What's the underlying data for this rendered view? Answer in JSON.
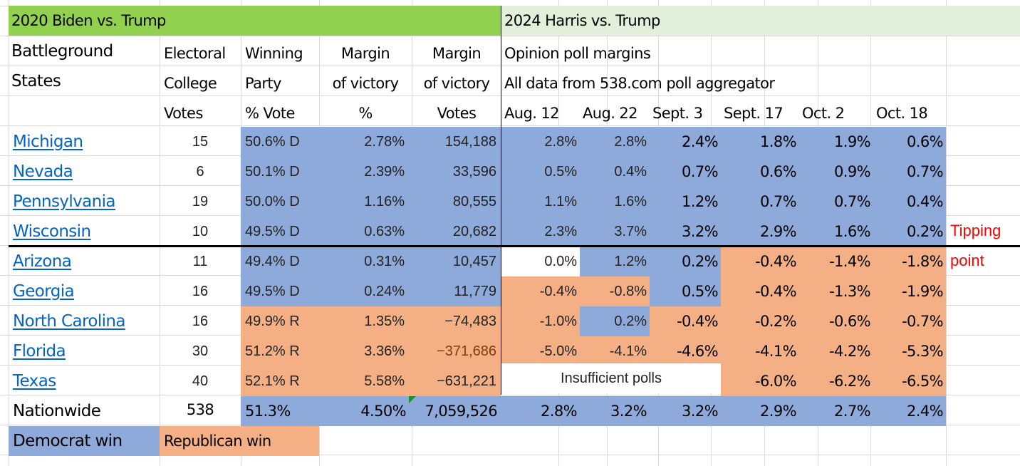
{
  "header": {
    "section_2020": "2020 Biden vs. Trump",
    "section_2024": "2024 Harris vs. Trump",
    "col_state": [
      "Battleground",
      "States",
      ""
    ],
    "col_ec": [
      "Electoral",
      "College",
      "Votes"
    ],
    "col_party": [
      "Winning",
      "Party",
      "% Vote"
    ],
    "col_margin_pct": [
      "Margin",
      "of victory",
      "%"
    ],
    "col_margin_votes": [
      "Margin",
      "of victory",
      "Votes"
    ],
    "poll_title": "Opinion poll margins",
    "poll_source": "All data from 538.com poll aggregator",
    "poll_dates": [
      "Aug. 12",
      "Aug. 22",
      "Sept. 3",
      "Sept. 17",
      "Oct. 2",
      "Oct. 18"
    ]
  },
  "rows": [
    {
      "state": "Michigan",
      "ec": "15",
      "party": "50.6% D",
      "margin_pct": "2.78%",
      "margin_votes": "154,188",
      "polls": [
        "2.8%",
        "2.8%",
        "2.4%",
        "1.8%",
        "1.9%",
        "0.6%"
      ],
      "poll_colors": [
        "D",
        "D",
        "D",
        "D",
        "D",
        "D"
      ],
      "win": "D"
    },
    {
      "state": "Nevada",
      "ec": "6",
      "party": "50.1% D",
      "margin_pct": "2.39%",
      "margin_votes": "33,596",
      "polls": [
        "0.5%",
        "0.4%",
        "0.7%",
        "0.6%",
        "0.9%",
        "0.7%"
      ],
      "poll_colors": [
        "D",
        "D",
        "D",
        "D",
        "D",
        "D"
      ],
      "win": "D"
    },
    {
      "state": "Pennsylvania",
      "ec": "19",
      "party": "50.0% D",
      "margin_pct": "1.16%",
      "margin_votes": "80,555",
      "polls": [
        "1.1%",
        "1.6%",
        "1.2%",
        "0.7%",
        "0.7%",
        "0.4%"
      ],
      "poll_colors": [
        "D",
        "D",
        "D",
        "D",
        "D",
        "D"
      ],
      "win": "D"
    },
    {
      "state": "Wisconsin",
      "ec": "10",
      "party": "49.5% D",
      "margin_pct": "0.63%",
      "margin_votes": "20,682",
      "polls": [
        "2.3%",
        "3.7%",
        "3.2%",
        "2.9%",
        "1.6%",
        "0.2%"
      ],
      "poll_colors": [
        "D",
        "D",
        "D",
        "D",
        "D",
        "D"
      ],
      "win": "D"
    },
    {
      "state": "Arizona",
      "ec": "11",
      "party": "49.4% D",
      "margin_pct": "0.31%",
      "margin_votes": "10,457",
      "polls": [
        "0.0%",
        "1.2%",
        "0.2%",
        "-0.4%",
        "-1.4%",
        "-1.8%"
      ],
      "poll_colors": [
        "N",
        "D",
        "D",
        "R",
        "R",
        "R"
      ],
      "win": "D"
    },
    {
      "state": "Georgia",
      "ec": "16",
      "party": "49.5% D",
      "margin_pct": "0.24%",
      "margin_votes": "11,779",
      "polls": [
        "-0.4%",
        "-0.8%",
        "0.5%",
        "-0.4%",
        "-1.3%",
        "-1.9%"
      ],
      "poll_colors": [
        "R",
        "R",
        "D",
        "R",
        "R",
        "R"
      ],
      "win": "D"
    },
    {
      "state": "North Carolina",
      "ec": "16",
      "party": "49.9% R",
      "margin_pct": "1.35%",
      "margin_votes": "−74,483",
      "polls": [
        "-1.0%",
        "0.2%",
        "-0.4%",
        "-0.2%",
        "-0.6%",
        "-0.7%"
      ],
      "poll_colors": [
        "R",
        "D",
        "R",
        "R",
        "R",
        "R"
      ],
      "win": "R"
    },
    {
      "state": "Florida",
      "ec": "30",
      "party": "51.2% R",
      "margin_pct": "3.36%",
      "margin_votes": "−371,686",
      "polls": [
        "-5.0%",
        "-4.1%",
        "-4.6%",
        "-4.1%",
        "-4.2%",
        "-5.3%"
      ],
      "poll_colors": [
        "R",
        "R",
        "R",
        "R",
        "R",
        "R"
      ],
      "win": "R"
    },
    {
      "state": "Texas",
      "ec": "40",
      "party": "52.1% R",
      "margin_pct": "5.58%",
      "margin_votes": "−631,221",
      "polls": [
        "",
        "",
        "",
        "-6.0%",
        "-6.2%",
        "-6.5%"
      ],
      "poll_colors": [
        "N",
        "N",
        "N",
        "R",
        "R",
        "R"
      ],
      "win": "R",
      "insufficient": "Insufficient polls"
    }
  ],
  "nationwide": {
    "label": "Nationwide",
    "ec": "538",
    "party": "51.3%",
    "margin_pct": "4.50%",
    "margin_votes": "7,059,526",
    "polls": [
      "2.8%",
      "3.2%",
      "3.2%",
      "2.9%",
      "2.7%",
      "2.4%"
    ]
  },
  "legend": {
    "democrat": "Democrat win",
    "republican": "Republican win"
  },
  "annotation": {
    "line1": "Tipping",
    "line2": "point"
  },
  "colors": {
    "democrat": "#8eaadb",
    "republican": "#f4b084",
    "header_2020": "#92d050",
    "header_2024": "#e2efda",
    "annotation": "#ff0000",
    "link": "#0563c1"
  }
}
